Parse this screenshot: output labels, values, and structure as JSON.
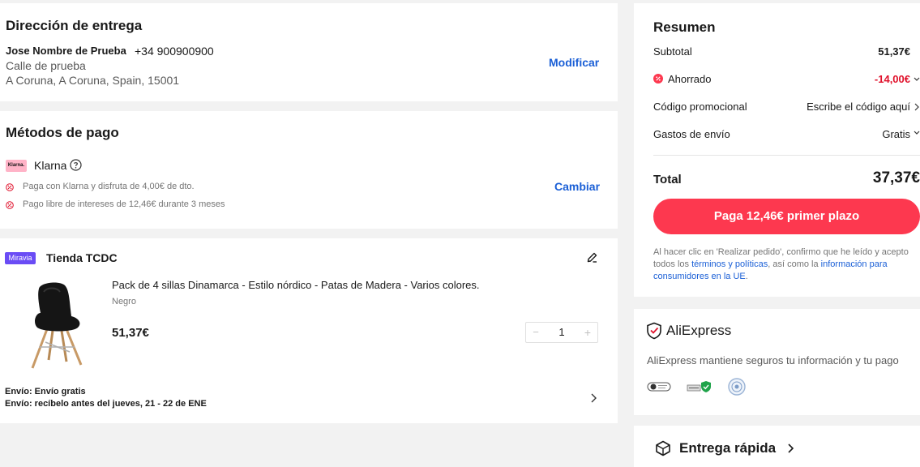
{
  "address": {
    "title": "Dirección de entrega",
    "name": "Jose Nombre de Prueba",
    "phone": "+34 900900900",
    "street": "Calle de prueba",
    "city_line": "A Coruna, A Coruna, Spain, 15001",
    "modify_label": "Modificar"
  },
  "payment": {
    "title": "Métodos de pago",
    "method_logo_text": "Klarna.",
    "method_name": "Klarna",
    "promo_1": "Paga con Klarna y disfruta de 4,00€ de dto.",
    "promo_2": "Pago libre de intereses de 12,46€ durante 3 meses",
    "change_label": "Cambiar"
  },
  "store": {
    "badge": "Miravia",
    "name": "Tienda TCDC",
    "product": {
      "title": "Pack de 4 sillas Dinamarca - Estilo nórdico - Patas de Madera - Varios colores.",
      "variant": "Negro",
      "price": "51,37€",
      "quantity": "1",
      "minus": "−",
      "plus": "+"
    },
    "shipping_line_1": "Envío: Envío gratis",
    "shipping_line_2": "Envío: recíbelo antes del jueves, 21 - 22 de ENE"
  },
  "summary": {
    "title": "Resumen",
    "subtotal_label": "Subtotal",
    "subtotal_value": "51,37€",
    "saved_label": "Ahorrado",
    "saved_value": "-14,00€",
    "promo_label": "Código promocional",
    "promo_value": "Escribe el código aquí",
    "shipping_label": "Gastos de envío",
    "shipping_value": "Gratis",
    "total_label": "Total",
    "total_value": "37,37€",
    "pay_button": "Paga 12,46€ primer plazo",
    "legal_prefix": "Al hacer clic en 'Realizar pedido', confirmo que he leído y acepto todos los ",
    "legal_link_1": "términos y políticas",
    "legal_middle": ", así como la ",
    "legal_link_2": "información para consumidores en la UE",
    "legal_suffix": "."
  },
  "security": {
    "brand": "AliExpress",
    "message": "AliExpress mantiene seguros tu información y tu pago"
  },
  "delivery": {
    "title": "Entrega rápida"
  },
  "colors": {
    "accent_red": "#fd384f",
    "saving_red": "#e0112b",
    "link_blue": "#1a5fd6",
    "klarna_pink": "#ffb3c7",
    "miravia_purple": "#6a4cf5"
  }
}
